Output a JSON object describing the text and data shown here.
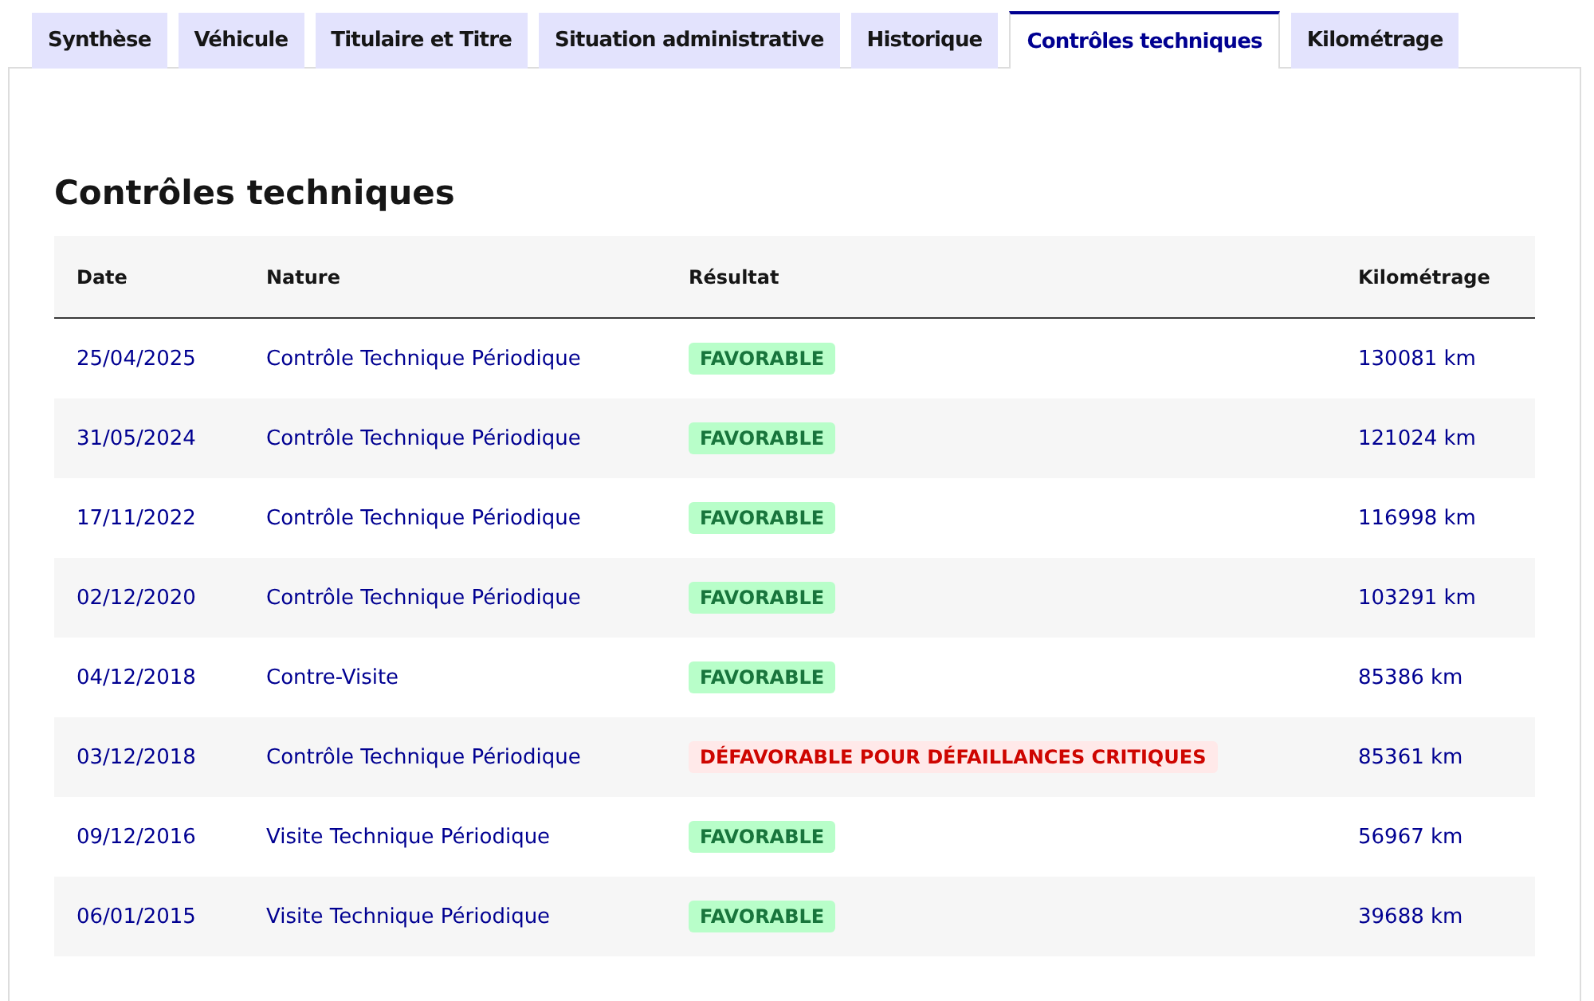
{
  "tabs": [
    {
      "label": "Synthèse",
      "selected": false
    },
    {
      "label": "Véhicule",
      "selected": false
    },
    {
      "label": "Titulaire et Titre",
      "selected": false
    },
    {
      "label": "Situation administrative",
      "selected": false
    },
    {
      "label": "Historique",
      "selected": false
    },
    {
      "label": "Contrôles techniques",
      "selected": true
    },
    {
      "label": "Kilométrage",
      "selected": false
    }
  ],
  "heading": "Contrôles techniques",
  "table": {
    "columns": [
      "Date",
      "Nature",
      "Résultat",
      "Kilométrage"
    ],
    "rows": [
      {
        "date": "25/04/2025",
        "nature": "Contrôle Technique Périodique",
        "result": {
          "label": "FAVORABLE",
          "kind": "success"
        },
        "mileage": "130081 km"
      },
      {
        "date": "31/05/2024",
        "nature": "Contrôle Technique Périodique",
        "result": {
          "label": "FAVORABLE",
          "kind": "success"
        },
        "mileage": "121024 km"
      },
      {
        "date": "17/11/2022",
        "nature": "Contrôle Technique Périodique",
        "result": {
          "label": "FAVORABLE",
          "kind": "success"
        },
        "mileage": "116998 km"
      },
      {
        "date": "02/12/2020",
        "nature": "Contrôle Technique Périodique",
        "result": {
          "label": "FAVORABLE",
          "kind": "success"
        },
        "mileage": "103291 km"
      },
      {
        "date": "04/12/2018",
        "nature": "Contre-Visite",
        "result": {
          "label": "FAVORABLE",
          "kind": "success"
        },
        "mileage": "85386 km"
      },
      {
        "date": "03/12/2018",
        "nature": "Contrôle Technique Périodique",
        "result": {
          "label": "DÉFAVORABLE POUR DÉFAILLANCES CRITIQUES",
          "kind": "error"
        },
        "mileage": "85361 km"
      },
      {
        "date": "09/12/2016",
        "nature": "Visite Technique Périodique",
        "result": {
          "label": "FAVORABLE",
          "kind": "success"
        },
        "mileage": "56967 km"
      },
      {
        "date": "06/01/2015",
        "nature": "Visite Technique Périodique",
        "result": {
          "label": "FAVORABLE",
          "kind": "success"
        },
        "mileage": "39688 km"
      }
    ]
  }
}
